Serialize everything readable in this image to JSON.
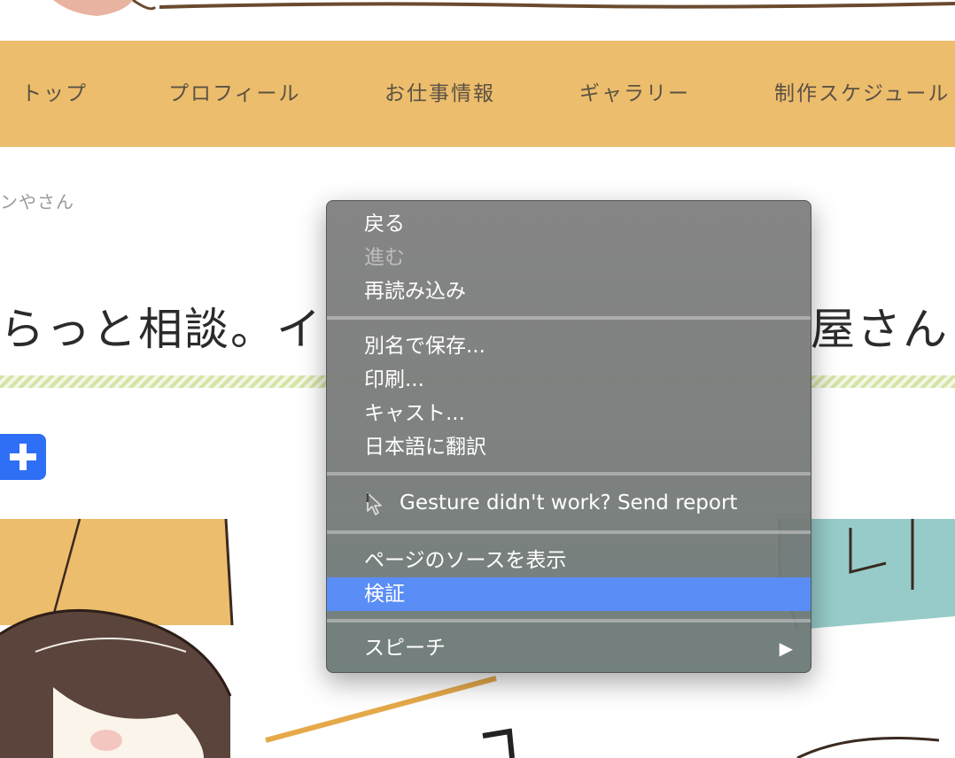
{
  "nav": {
    "items": [
      "トップ",
      "プロフィール",
      "お仕事情報",
      "ギャラリー",
      "制作スケジュール"
    ]
  },
  "breadcrumb": "ンやさん",
  "article": {
    "title_left": "らっと相談。イ",
    "title_right": "屋さん"
  },
  "context_menu": {
    "back": "戻る",
    "forward": "進む",
    "reload": "再読み込み",
    "save_as": "別名で保存...",
    "print": "印刷...",
    "cast": "キャスト...",
    "translate": "日本語に翻訳",
    "gesture_report": "Gesture didn't work? Send report",
    "view_source": "ページのソースを表示",
    "inspect": "検証",
    "speech": "スピーチ",
    "submenu_arrow": "▶"
  },
  "colors": {
    "nav_background": "#ecbd6c",
    "menu_highlight": "#5a8df5",
    "hatena_button": "#2f6ff6"
  }
}
